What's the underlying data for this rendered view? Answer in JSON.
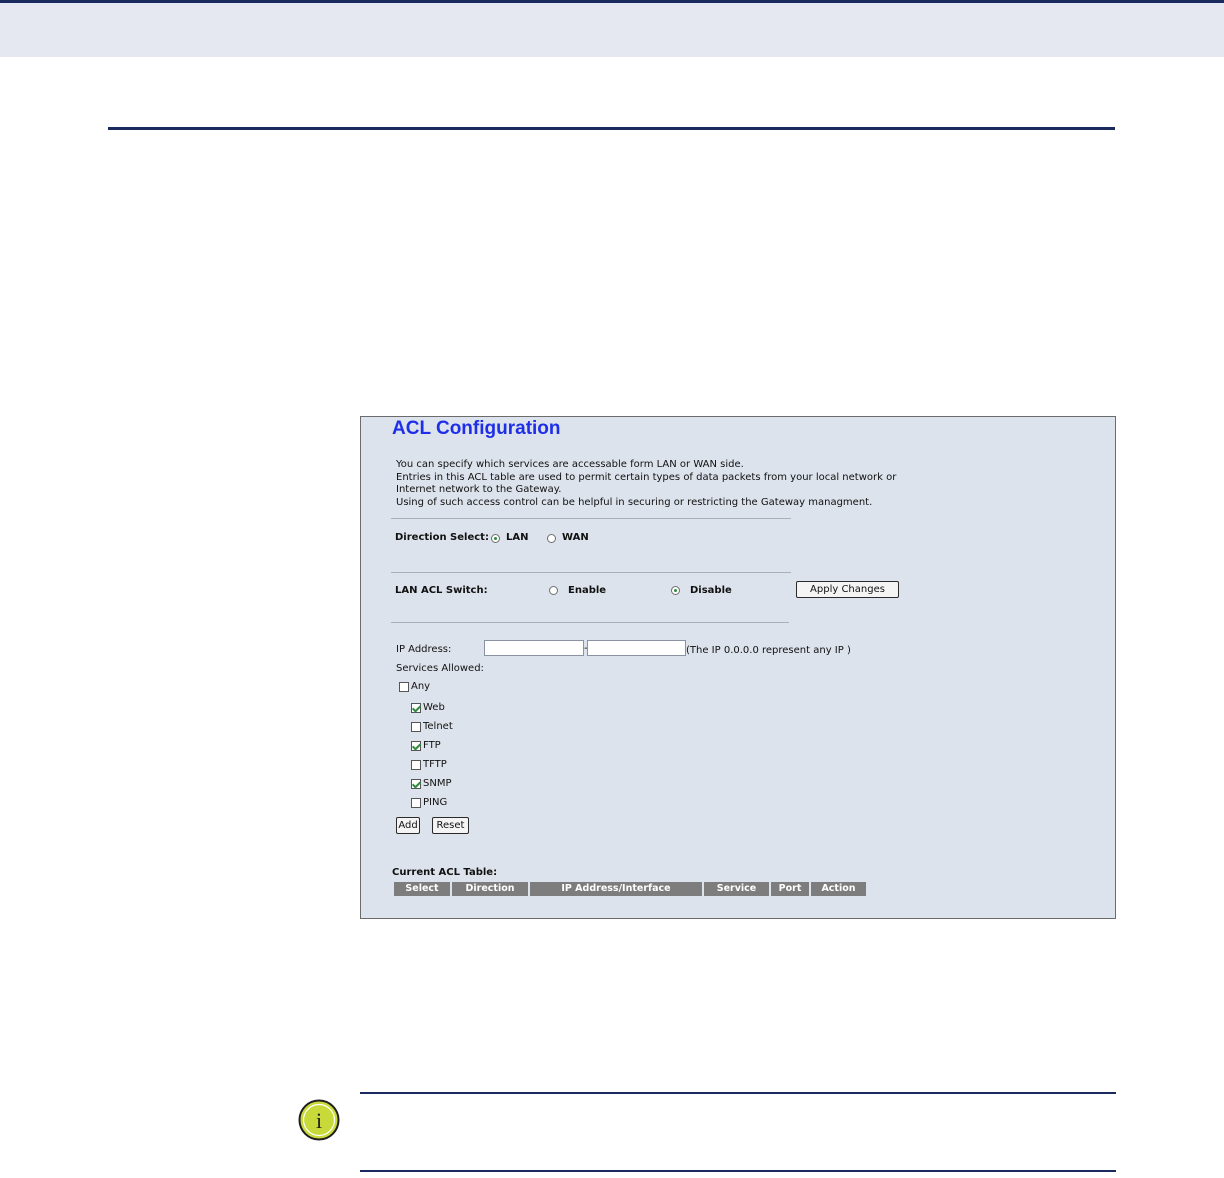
{
  "acl": {
    "title": "ACL Configuration",
    "description": [
      "You can specify which services are accessable form LAN or WAN side.",
      "Entries in this ACL table are used to permit certain types of data packets from your local network or",
      "Internet network to the Gateway.",
      "Using of such access control can be helpful in securing or restricting the Gateway managment."
    ],
    "direction": {
      "label": "Direction Select:",
      "lan": "LAN",
      "wan": "WAN",
      "selected": "LAN"
    },
    "switch": {
      "label": "LAN ACL Switch:",
      "enable": "Enable",
      "disable": "Disable",
      "selected": "Disable",
      "apply_label": "Apply Changes"
    },
    "ip": {
      "label": "IP Address:",
      "start_value": "",
      "end_value": "",
      "separator": "-",
      "hint": "(The IP 0.0.0.0 represent any IP )"
    },
    "services": {
      "label": "Services Allowed:",
      "any": {
        "label": "Any",
        "checked": false
      },
      "items": [
        {
          "label": "Web",
          "checked": true
        },
        {
          "label": "Telnet",
          "checked": false
        },
        {
          "label": "FTP",
          "checked": true
        },
        {
          "label": "TFTP",
          "checked": false
        },
        {
          "label": "SNMP",
          "checked": true
        },
        {
          "label": "PING",
          "checked": false
        }
      ]
    },
    "add_label": "Add",
    "reset_label": "Reset",
    "table": {
      "title": "Current ACL Table:",
      "columns": [
        "Select",
        "Direction",
        "IP Address/Interface",
        "Service",
        "Port",
        "Action"
      ]
    }
  },
  "note": {
    "icon": "info-icon",
    "icon_glyph": "i"
  },
  "colors": {
    "accent": "#1a2a5e",
    "title": "#1f2fe8",
    "panel": "#dde3ec",
    "header_bar": "#e5e8f0",
    "table_header": "#7d7d7d",
    "check": "#2e8b3e",
    "icon_fill": "#c8da3a"
  }
}
